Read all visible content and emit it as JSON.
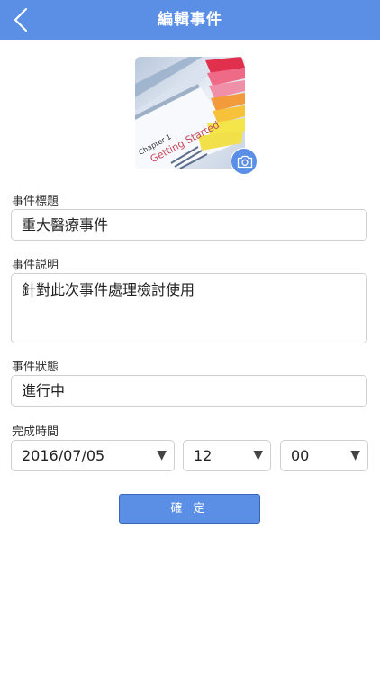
{
  "header": {
    "title": "編輯事件",
    "back_icon": "chevron-left-icon"
  },
  "photo": {
    "camera_icon": "camera-icon",
    "book_text": "Getting Started",
    "chapter_text": "Chapter 1"
  },
  "form": {
    "title_label": "事件標題",
    "title_value": "重大醫療事件",
    "desc_label": "事件説明",
    "desc_value": "針對此次事件處理檢討使用",
    "status_label": "事件狀態",
    "status_value": "進行中",
    "time_label": "完成時間",
    "date_value": "2016/07/05",
    "hour_value": "12",
    "minute_value": "00",
    "dropdown_arrow": "▼"
  },
  "confirm_label": "確 定",
  "colors": {
    "accent": "#5b8fe6",
    "border": "#cfcfcf"
  }
}
